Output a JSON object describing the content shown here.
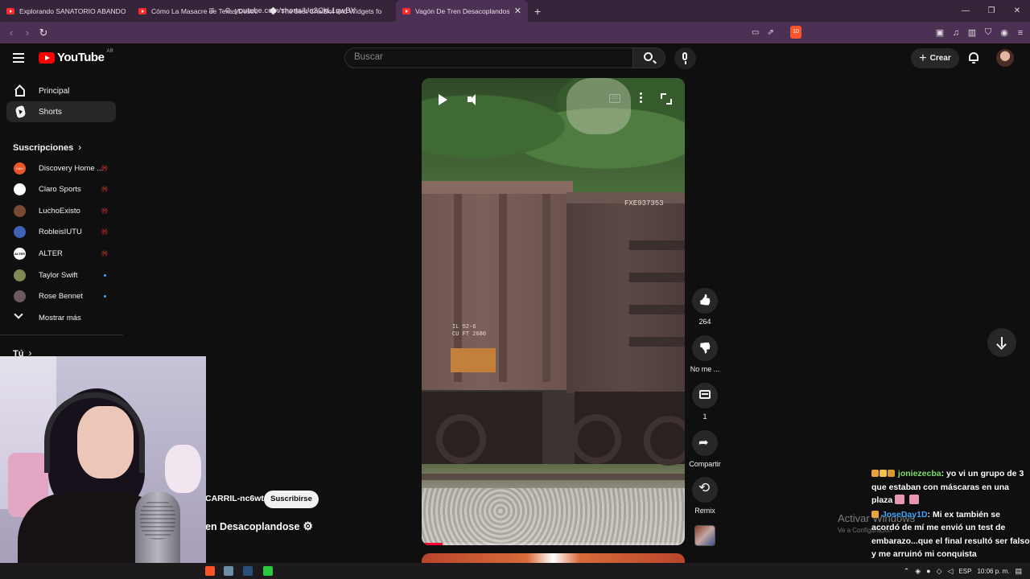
{
  "browser": {
    "tabs": [
      {
        "title": "Explorando SANATORIO ABANDONA",
        "active": false
      },
      {
        "title": "Cómo La Masacre de Texas Destruyó",
        "active": false
      },
      {
        "title": "The best ChatBot and Widgets fo",
        "active": false
      },
      {
        "title": "Vagón De Tren Desacoplandose",
        "active": true
      }
    ],
    "url": "youtube.com/shorts/Ua3CkL1qwBY",
    "brave_badge": "10"
  },
  "masthead": {
    "logo_text": "YouTube",
    "country_code": "AR",
    "search_placeholder": "Buscar",
    "create_label": "Crear"
  },
  "sidebar": {
    "items": [
      {
        "label": "Principal",
        "icon": "home-icon"
      },
      {
        "label": "Shorts",
        "icon": "shorts-icon",
        "active": true
      }
    ],
    "subscriptions_heading": "Suscripciones",
    "subscriptions": [
      {
        "name": "Discovery Home ...",
        "status": "live",
        "avatar_color": "#e8562a",
        "avatar_text": "H&H"
      },
      {
        "name": "Claro Sports",
        "status": "live",
        "avatar_color": "#ffffff",
        "avatar_text": ""
      },
      {
        "name": "LuchoExisto",
        "status": "live",
        "avatar_color": "#7a4b33",
        "avatar_text": ""
      },
      {
        "name": "RobleisIUTU",
        "status": "live",
        "avatar_color": "#3f63b5",
        "avatar_text": ""
      },
      {
        "name": "ALTER",
        "status": "live",
        "avatar_color": "#ffffff",
        "avatar_text": "ALTER"
      },
      {
        "name": "Taylor Swift",
        "status": "new",
        "avatar_color": "#7f8a55",
        "avatar_text": ""
      },
      {
        "name": "Rose Bennet",
        "status": "new",
        "avatar_color": "#6b5a5f",
        "avatar_text": ""
      }
    ],
    "show_more": "Mostrar más",
    "you_heading": "Tú"
  },
  "video": {
    "car_label_top": "FXE937353",
    "car_label_left": "IL 52-6\nCU FT 2680",
    "progress": 0.08,
    "channel": "CARRIL-nc6wt",
    "subscribe_label": "Suscribirse",
    "title": "en Desacoplandose"
  },
  "actions": {
    "likes": "264",
    "dislike_label": "No me ...",
    "comments": "1",
    "share_label": "Compartir",
    "remix_label": "Remix"
  },
  "chat": [
    {
      "user": "joniezecba",
      "message": ": yo vi un grupo de 3 que estaban con máscaras en una plaza"
    },
    {
      "user": "JoseDay1D",
      "message": ": Mi ex también se acordó de mí me envió un test de embarazo...que el final resultó ser falso y me arruinó mi conquista"
    }
  ],
  "windows_watermark": {
    "line1": "Activar Windows",
    "line2": "Ve a Configuración"
  },
  "taskbar": {
    "lang": "ESP",
    "time": "10:06 p. m."
  }
}
